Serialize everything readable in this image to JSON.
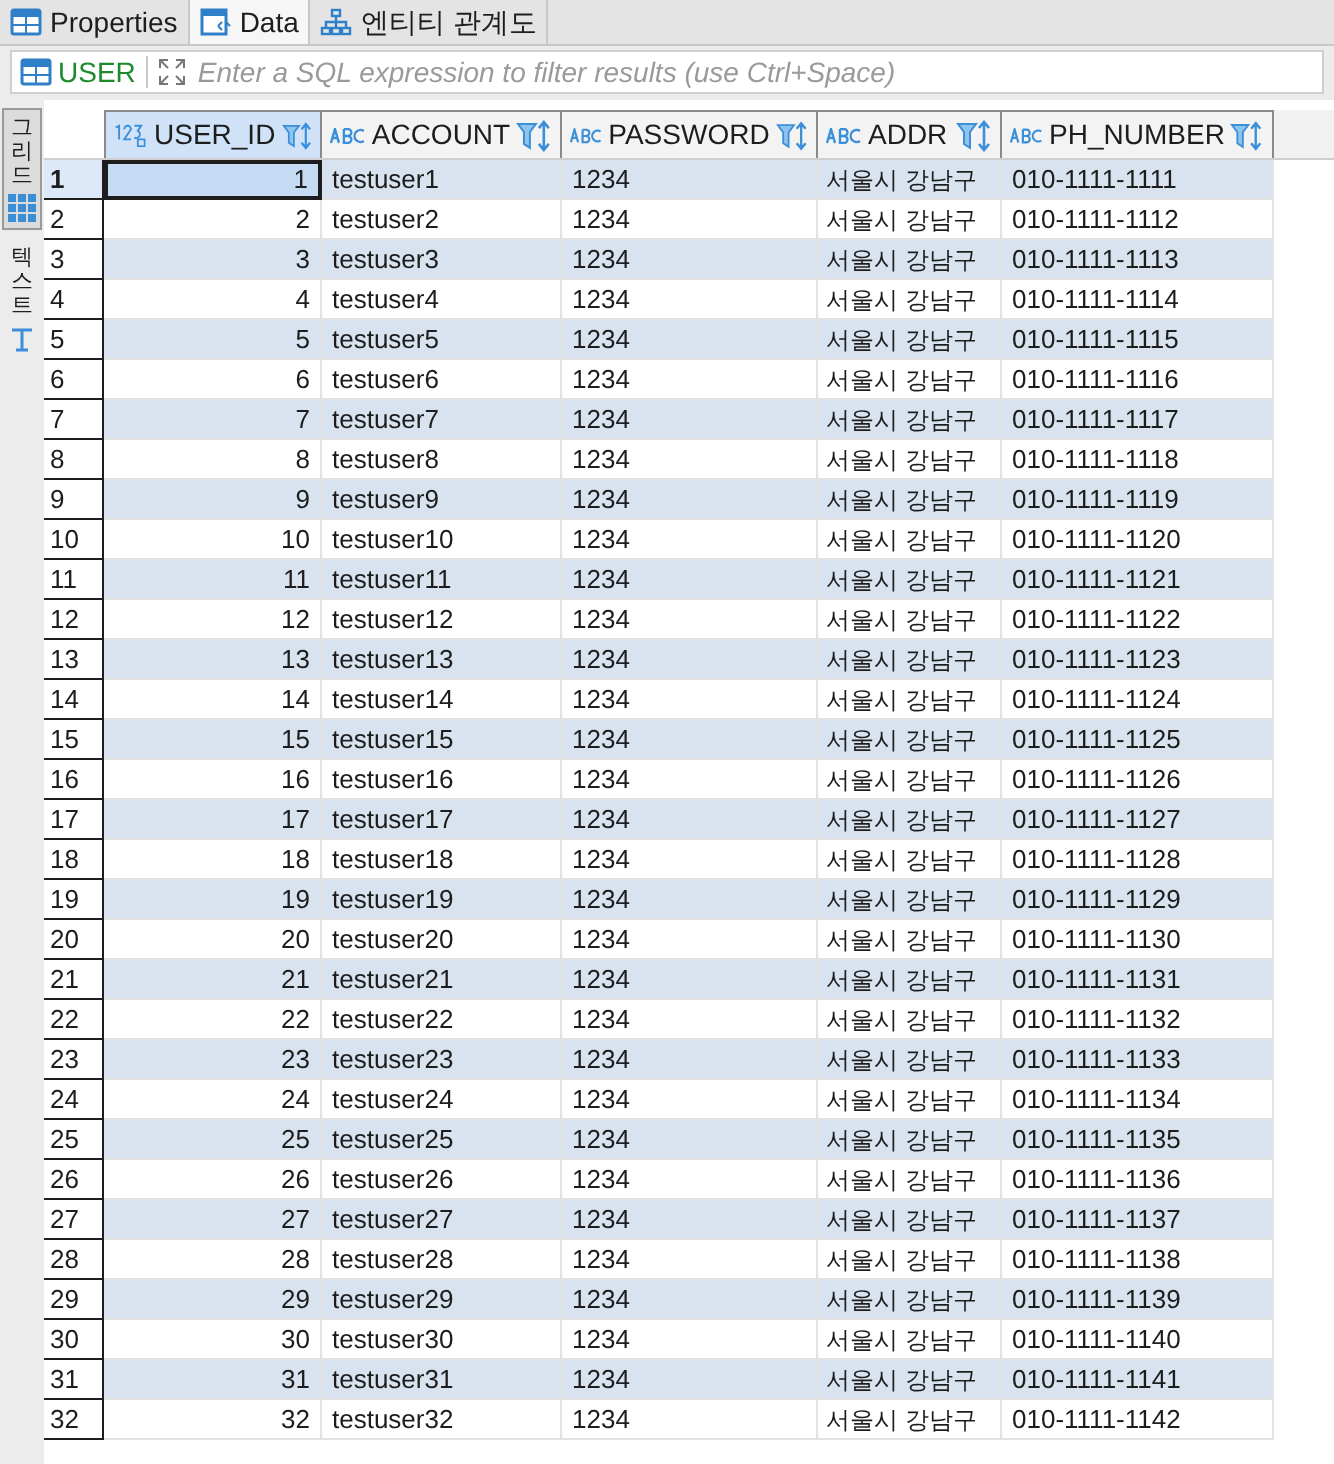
{
  "tabs": [
    {
      "label": "Properties",
      "kind": "table",
      "selected": false
    },
    {
      "label": "Data",
      "kind": "data",
      "selected": true
    },
    {
      "label": "엔티티 관계도",
      "kind": "diagram",
      "selected": false
    }
  ],
  "filter": {
    "table": "USER",
    "placeholder": "Enter a SQL expression to filter results (use Ctrl+Space)"
  },
  "side_tabs": [
    {
      "label": "그리드",
      "kind": "grid",
      "selected": true
    },
    {
      "label": "텍스트",
      "kind": "text",
      "selected": false
    }
  ],
  "table": {
    "columns": [
      {
        "label": "USER_ID",
        "kind": "number"
      },
      {
        "label": "ACCOUNT",
        "kind": "text"
      },
      {
        "label": "PASSWORD",
        "kind": "text"
      },
      {
        "label": "ADDR",
        "kind": "text"
      },
      {
        "label": "PH_NUMBER",
        "kind": "text"
      }
    ],
    "rows": [
      {
        "num": "1",
        "cells": [
          "1",
          "testuser1",
          "1234",
          "서울시 강남구",
          "010-1111-1111"
        ],
        "selected": true
      },
      {
        "num": "2",
        "cells": [
          "2",
          "testuser2",
          "1234",
          "서울시 강남구",
          "010-1111-1112"
        ],
        "selected": false
      },
      {
        "num": "3",
        "cells": [
          "3",
          "testuser3",
          "1234",
          "서울시 강남구",
          "010-1111-1113"
        ],
        "selected": false
      },
      {
        "num": "4",
        "cells": [
          "4",
          "testuser4",
          "1234",
          "서울시 강남구",
          "010-1111-1114"
        ],
        "selected": false
      },
      {
        "num": "5",
        "cells": [
          "5",
          "testuser5",
          "1234",
          "서울시 강남구",
          "010-1111-1115"
        ],
        "selected": false
      },
      {
        "num": "6",
        "cells": [
          "6",
          "testuser6",
          "1234",
          "서울시 강남구",
          "010-1111-1116"
        ],
        "selected": false
      },
      {
        "num": "7",
        "cells": [
          "7",
          "testuser7",
          "1234",
          "서울시 강남구",
          "010-1111-1117"
        ],
        "selected": false
      },
      {
        "num": "8",
        "cells": [
          "8",
          "testuser8",
          "1234",
          "서울시 강남구",
          "010-1111-1118"
        ],
        "selected": false
      },
      {
        "num": "9",
        "cells": [
          "9",
          "testuser9",
          "1234",
          "서울시 강남구",
          "010-1111-1119"
        ],
        "selected": false
      },
      {
        "num": "10",
        "cells": [
          "10",
          "testuser10",
          "1234",
          "서울시 강남구",
          "010-1111-1120"
        ],
        "selected": false
      },
      {
        "num": "11",
        "cells": [
          "11",
          "testuser11",
          "1234",
          "서울시 강남구",
          "010-1111-1121"
        ],
        "selected": false
      },
      {
        "num": "12",
        "cells": [
          "12",
          "testuser12",
          "1234",
          "서울시 강남구",
          "010-1111-1122"
        ],
        "selected": false
      },
      {
        "num": "13",
        "cells": [
          "13",
          "testuser13",
          "1234",
          "서울시 강남구",
          "010-1111-1123"
        ],
        "selected": false
      },
      {
        "num": "14",
        "cells": [
          "14",
          "testuser14",
          "1234",
          "서울시 강남구",
          "010-1111-1124"
        ],
        "selected": false
      },
      {
        "num": "15",
        "cells": [
          "15",
          "testuser15",
          "1234",
          "서울시 강남구",
          "010-1111-1125"
        ],
        "selected": false
      },
      {
        "num": "16",
        "cells": [
          "16",
          "testuser16",
          "1234",
          "서울시 강남구",
          "010-1111-1126"
        ],
        "selected": false
      },
      {
        "num": "17",
        "cells": [
          "17",
          "testuser17",
          "1234",
          "서울시 강남구",
          "010-1111-1127"
        ],
        "selected": false
      },
      {
        "num": "18",
        "cells": [
          "18",
          "testuser18",
          "1234",
          "서울시 강남구",
          "010-1111-1128"
        ],
        "selected": false
      },
      {
        "num": "19",
        "cells": [
          "19",
          "testuser19",
          "1234",
          "서울시 강남구",
          "010-1111-1129"
        ],
        "selected": false
      },
      {
        "num": "20",
        "cells": [
          "20",
          "testuser20",
          "1234",
          "서울시 강남구",
          "010-1111-1130"
        ],
        "selected": false
      },
      {
        "num": "21",
        "cells": [
          "21",
          "testuser21",
          "1234",
          "서울시 강남구",
          "010-1111-1131"
        ],
        "selected": false
      },
      {
        "num": "22",
        "cells": [
          "22",
          "testuser22",
          "1234",
          "서울시 강남구",
          "010-1111-1132"
        ],
        "selected": false
      },
      {
        "num": "23",
        "cells": [
          "23",
          "testuser23",
          "1234",
          "서울시 강남구",
          "010-1111-1133"
        ],
        "selected": false
      },
      {
        "num": "24",
        "cells": [
          "24",
          "testuser24",
          "1234",
          "서울시 강남구",
          "010-1111-1134"
        ],
        "selected": false
      },
      {
        "num": "25",
        "cells": [
          "25",
          "testuser25",
          "1234",
          "서울시 강남구",
          "010-1111-1135"
        ],
        "selected": false
      },
      {
        "num": "26",
        "cells": [
          "26",
          "testuser26",
          "1234",
          "서울시 강남구",
          "010-1111-1136"
        ],
        "selected": false
      },
      {
        "num": "27",
        "cells": [
          "27",
          "testuser27",
          "1234",
          "서울시 강남구",
          "010-1111-1137"
        ],
        "selected": false
      },
      {
        "num": "28",
        "cells": [
          "28",
          "testuser28",
          "1234",
          "서울시 강남구",
          "010-1111-1138"
        ],
        "selected": false
      },
      {
        "num": "29",
        "cells": [
          "29",
          "testuser29",
          "1234",
          "서울시 강남구",
          "010-1111-1139"
        ],
        "selected": false
      },
      {
        "num": "30",
        "cells": [
          "30",
          "testuser30",
          "1234",
          "서울시 강남구",
          "010-1111-1140"
        ],
        "selected": false
      },
      {
        "num": "31",
        "cells": [
          "31",
          "testuser31",
          "1234",
          "서울시 강남구",
          "010-1111-1141"
        ],
        "selected": false
      },
      {
        "num": "32",
        "cells": [
          "32",
          "testuser32",
          "1234",
          "서울시 강남구",
          "010-1111-1142"
        ],
        "selected": false
      }
    ]
  }
}
